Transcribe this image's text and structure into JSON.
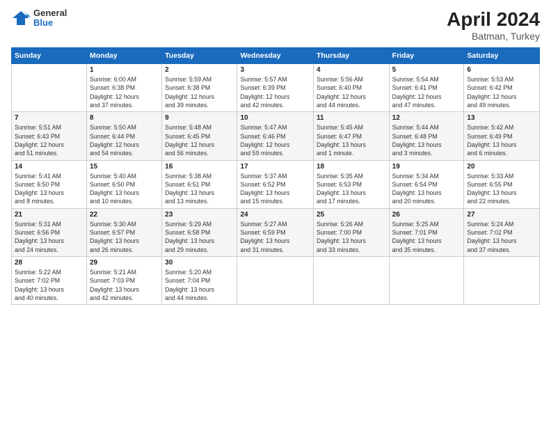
{
  "logo": {
    "general": "General",
    "blue": "Blue"
  },
  "title": {
    "month": "April 2024",
    "location": "Batman, Turkey"
  },
  "days_of_week": [
    "Sunday",
    "Monday",
    "Tuesday",
    "Wednesday",
    "Thursday",
    "Friday",
    "Saturday"
  ],
  "weeks": [
    [
      {
        "day": "",
        "info": ""
      },
      {
        "day": "1",
        "info": "Sunrise: 6:00 AM\nSunset: 6:38 PM\nDaylight: 12 hours\nand 37 minutes."
      },
      {
        "day": "2",
        "info": "Sunrise: 5:59 AM\nSunset: 6:38 PM\nDaylight: 12 hours\nand 39 minutes."
      },
      {
        "day": "3",
        "info": "Sunrise: 5:57 AM\nSunset: 6:39 PM\nDaylight: 12 hours\nand 42 minutes."
      },
      {
        "day": "4",
        "info": "Sunrise: 5:56 AM\nSunset: 6:40 PM\nDaylight: 12 hours\nand 44 minutes."
      },
      {
        "day": "5",
        "info": "Sunrise: 5:54 AM\nSunset: 6:41 PM\nDaylight: 12 hours\nand 47 minutes."
      },
      {
        "day": "6",
        "info": "Sunrise: 5:53 AM\nSunset: 6:42 PM\nDaylight: 12 hours\nand 49 minutes."
      }
    ],
    [
      {
        "day": "7",
        "info": "Sunrise: 5:51 AM\nSunset: 6:43 PM\nDaylight: 12 hours\nand 51 minutes."
      },
      {
        "day": "8",
        "info": "Sunrise: 5:50 AM\nSunset: 6:44 PM\nDaylight: 12 hours\nand 54 minutes."
      },
      {
        "day": "9",
        "info": "Sunrise: 5:48 AM\nSunset: 6:45 PM\nDaylight: 12 hours\nand 56 minutes."
      },
      {
        "day": "10",
        "info": "Sunrise: 5:47 AM\nSunset: 6:46 PM\nDaylight: 12 hours\nand 59 minutes."
      },
      {
        "day": "11",
        "info": "Sunrise: 5:45 AM\nSunset: 6:47 PM\nDaylight: 13 hours\nand 1 minute."
      },
      {
        "day": "12",
        "info": "Sunrise: 5:44 AM\nSunset: 6:48 PM\nDaylight: 13 hours\nand 3 minutes."
      },
      {
        "day": "13",
        "info": "Sunrise: 5:42 AM\nSunset: 6:49 PM\nDaylight: 13 hours\nand 6 minutes."
      }
    ],
    [
      {
        "day": "14",
        "info": "Sunrise: 5:41 AM\nSunset: 6:50 PM\nDaylight: 13 hours\nand 8 minutes."
      },
      {
        "day": "15",
        "info": "Sunrise: 5:40 AM\nSunset: 6:50 PM\nDaylight: 13 hours\nand 10 minutes."
      },
      {
        "day": "16",
        "info": "Sunrise: 5:38 AM\nSunset: 6:51 PM\nDaylight: 13 hours\nand 13 minutes."
      },
      {
        "day": "17",
        "info": "Sunrise: 5:37 AM\nSunset: 6:52 PM\nDaylight: 13 hours\nand 15 minutes."
      },
      {
        "day": "18",
        "info": "Sunrise: 5:35 AM\nSunset: 6:53 PM\nDaylight: 13 hours\nand 17 minutes."
      },
      {
        "day": "19",
        "info": "Sunrise: 5:34 AM\nSunset: 6:54 PM\nDaylight: 13 hours\nand 20 minutes."
      },
      {
        "day": "20",
        "info": "Sunrise: 5:33 AM\nSunset: 6:55 PM\nDaylight: 13 hours\nand 22 minutes."
      }
    ],
    [
      {
        "day": "21",
        "info": "Sunrise: 5:31 AM\nSunset: 6:56 PM\nDaylight: 13 hours\nand 24 minutes."
      },
      {
        "day": "22",
        "info": "Sunrise: 5:30 AM\nSunset: 6:57 PM\nDaylight: 13 hours\nand 26 minutes."
      },
      {
        "day": "23",
        "info": "Sunrise: 5:29 AM\nSunset: 6:58 PM\nDaylight: 13 hours\nand 29 minutes."
      },
      {
        "day": "24",
        "info": "Sunrise: 5:27 AM\nSunset: 6:59 PM\nDaylight: 13 hours\nand 31 minutes."
      },
      {
        "day": "25",
        "info": "Sunrise: 5:26 AM\nSunset: 7:00 PM\nDaylight: 13 hours\nand 33 minutes."
      },
      {
        "day": "26",
        "info": "Sunrise: 5:25 AM\nSunset: 7:01 PM\nDaylight: 13 hours\nand 35 minutes."
      },
      {
        "day": "27",
        "info": "Sunrise: 5:24 AM\nSunset: 7:02 PM\nDaylight: 13 hours\nand 37 minutes."
      }
    ],
    [
      {
        "day": "28",
        "info": "Sunrise: 5:22 AM\nSunset: 7:02 PM\nDaylight: 13 hours\nand 40 minutes."
      },
      {
        "day": "29",
        "info": "Sunrise: 5:21 AM\nSunset: 7:03 PM\nDaylight: 13 hours\nand 42 minutes."
      },
      {
        "day": "30",
        "info": "Sunrise: 5:20 AM\nSunset: 7:04 PM\nDaylight: 13 hours\nand 44 minutes."
      },
      {
        "day": "",
        "info": ""
      },
      {
        "day": "",
        "info": ""
      },
      {
        "day": "",
        "info": ""
      },
      {
        "day": "",
        "info": ""
      }
    ]
  ]
}
